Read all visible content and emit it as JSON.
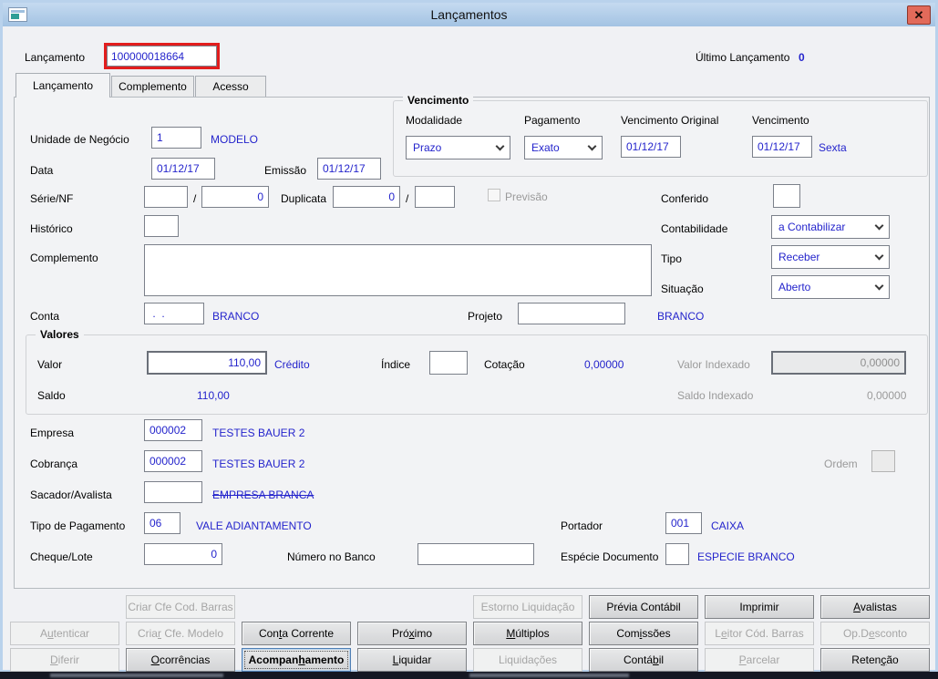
{
  "colors": {
    "navy": "#2424cc",
    "red": "#e21d1d",
    "titlebar-top": "#c5daf0",
    "titlebar-bottom": "#a3c3e3",
    "close-bg": "#e26a5a",
    "disabled-text": "#a5a5a5"
  },
  "window": {
    "title": "Lançamentos",
    "close_glyph": "✕"
  },
  "header": {
    "lancamento_label": "Lançamento",
    "lancamento_value": "100000018664",
    "ultimo_label": "Último Lançamento",
    "ultimo_value": "0"
  },
  "tabs": {
    "t1": "Lançamento",
    "t2": "Complemento",
    "t3": "Acesso"
  },
  "form": {
    "unidade_label": "Unidade de Negócio",
    "unidade_value": "1",
    "unidade_desc": "MODELO",
    "data_label": "Data",
    "data_value": "01/12/17",
    "emissao_label": "Emissão",
    "emissao_value": "01/12/17",
    "serie_label": "Série/NF",
    "serie_value": "",
    "serie_sep": "/",
    "nf_value": "0",
    "duplicata_label": "Duplicata",
    "duplicata_value": "0",
    "duplicata_sep": "/",
    "duplicata_parc_value": "",
    "previsao_label": "Previsão",
    "conferido_label": "Conferido",
    "conferido_value": "",
    "historico_label": "Histórico",
    "historico_value": "",
    "contabilidade_label": "Contabilidade",
    "contabilidade_value": "a Contabilizar",
    "complemento_label": "Complemento",
    "complemento_value": "",
    "tipo_label": "Tipo",
    "tipo_value": "Receber",
    "situacao_label": "Situação",
    "situacao_value": "Aberto",
    "conta_label": "Conta",
    "conta_value": " .  .",
    "conta_desc": "BRANCO",
    "projeto_label": "Projeto",
    "projeto_value": "",
    "projeto_desc": "BRANCO"
  },
  "vencimento": {
    "title": "Vencimento",
    "modalidade_label": "Modalidade",
    "modalidade_value": "Prazo",
    "pagamento_label": "Pagamento",
    "pagamento_value": "Exato",
    "venc_orig_label": "Vencimento Original",
    "venc_orig_value": "01/12/17",
    "venc_label": "Vencimento",
    "venc_value": "01/12/17",
    "venc_weekday": "Sexta"
  },
  "valores": {
    "title": "Valores",
    "valor_label": "Valor",
    "valor_value": "110,00",
    "credito_label": "Crédito",
    "indice_label": "Índice",
    "indice_value": "",
    "cotacao_label": "Cotação",
    "cotacao_value": "0,00000",
    "valor_indexado_label": "Valor Indexado",
    "valor_indexado_value": "0,00000",
    "saldo_label": "Saldo",
    "saldo_value": "110,00",
    "saldo_indexado_label": "Saldo Indexado",
    "saldo_indexado_value": "0,00000"
  },
  "parties": {
    "empresa_label": "Empresa",
    "empresa_value": "000002",
    "empresa_desc": "TESTES BAUER 2",
    "cobranca_label": "Cobrança",
    "cobranca_value": "000002",
    "cobranca_desc": "TESTES BAUER 2",
    "ordem_label": "Ordem",
    "sacador_label": "Sacador/Avalista",
    "sacador_value": "",
    "sacador_desc": "EMPRESA BRANCA"
  },
  "payment": {
    "tipo_pag_label": "Tipo de Pagamento",
    "tipo_pag_value": "06",
    "tipo_pag_desc": "VALE ADIANTAMENTO",
    "portador_label": "Portador",
    "portador_value": "001",
    "portador_desc": "CAIXA",
    "cheque_label": "Cheque/Lote",
    "cheque_value": "0",
    "numero_banco_label": "Número no Banco",
    "numero_banco_value": "",
    "especie_label": "Espécie Documento",
    "especie_value": "",
    "especie_desc": "ESPECIE BRANCO"
  },
  "buttons": {
    "rows": [
      [
        {
          "label": "",
          "state": "empty"
        },
        {
          "label": "Criar Cfe Cod. Barras",
          "state": "disabled"
        },
        {
          "label": "",
          "state": "empty"
        },
        {
          "label": "",
          "state": "empty"
        },
        {
          "label": "Estorno Liquidação",
          "state": "disabled"
        },
        {
          "label": "Prévia Contábil",
          "state": "enabled"
        },
        {
          "label": "Imprimir",
          "state": "enabled"
        },
        {
          "label": "&Avalistas",
          "state": "enabled"
        }
      ],
      [
        {
          "label": "A&utenticar",
          "state": "disabled"
        },
        {
          "label": "Cria&r Cfe. Modelo",
          "state": "disabled"
        },
        {
          "label": "Con&ta Corrente",
          "state": "enabled"
        },
        {
          "label": "Pró&ximo",
          "state": "enabled"
        },
        {
          "label": "&Múltiplos",
          "state": "enabled"
        },
        {
          "label": "Com&issões",
          "state": "enabled"
        },
        {
          "label": "L&eitor Cód. Barras",
          "state": "disabled"
        },
        {
          "label": "Op.D&esconto",
          "state": "disabled"
        }
      ],
      [
        {
          "label": "&Diferir",
          "state": "disabled"
        },
        {
          "label": "&Ocorrências",
          "state": "enabled"
        },
        {
          "label": "Acompan&hamento",
          "state": "focused"
        },
        {
          "label": "&Liquidar",
          "state": "enabled"
        },
        {
          "label": "Liquidações",
          "state": "disabled"
        },
        {
          "label": "Contá&bil",
          "state": "enabled"
        },
        {
          "label": "&Parcelar",
          "state": "disabled"
        },
        {
          "label": "Reten&ção",
          "state": "enabled"
        }
      ]
    ]
  }
}
